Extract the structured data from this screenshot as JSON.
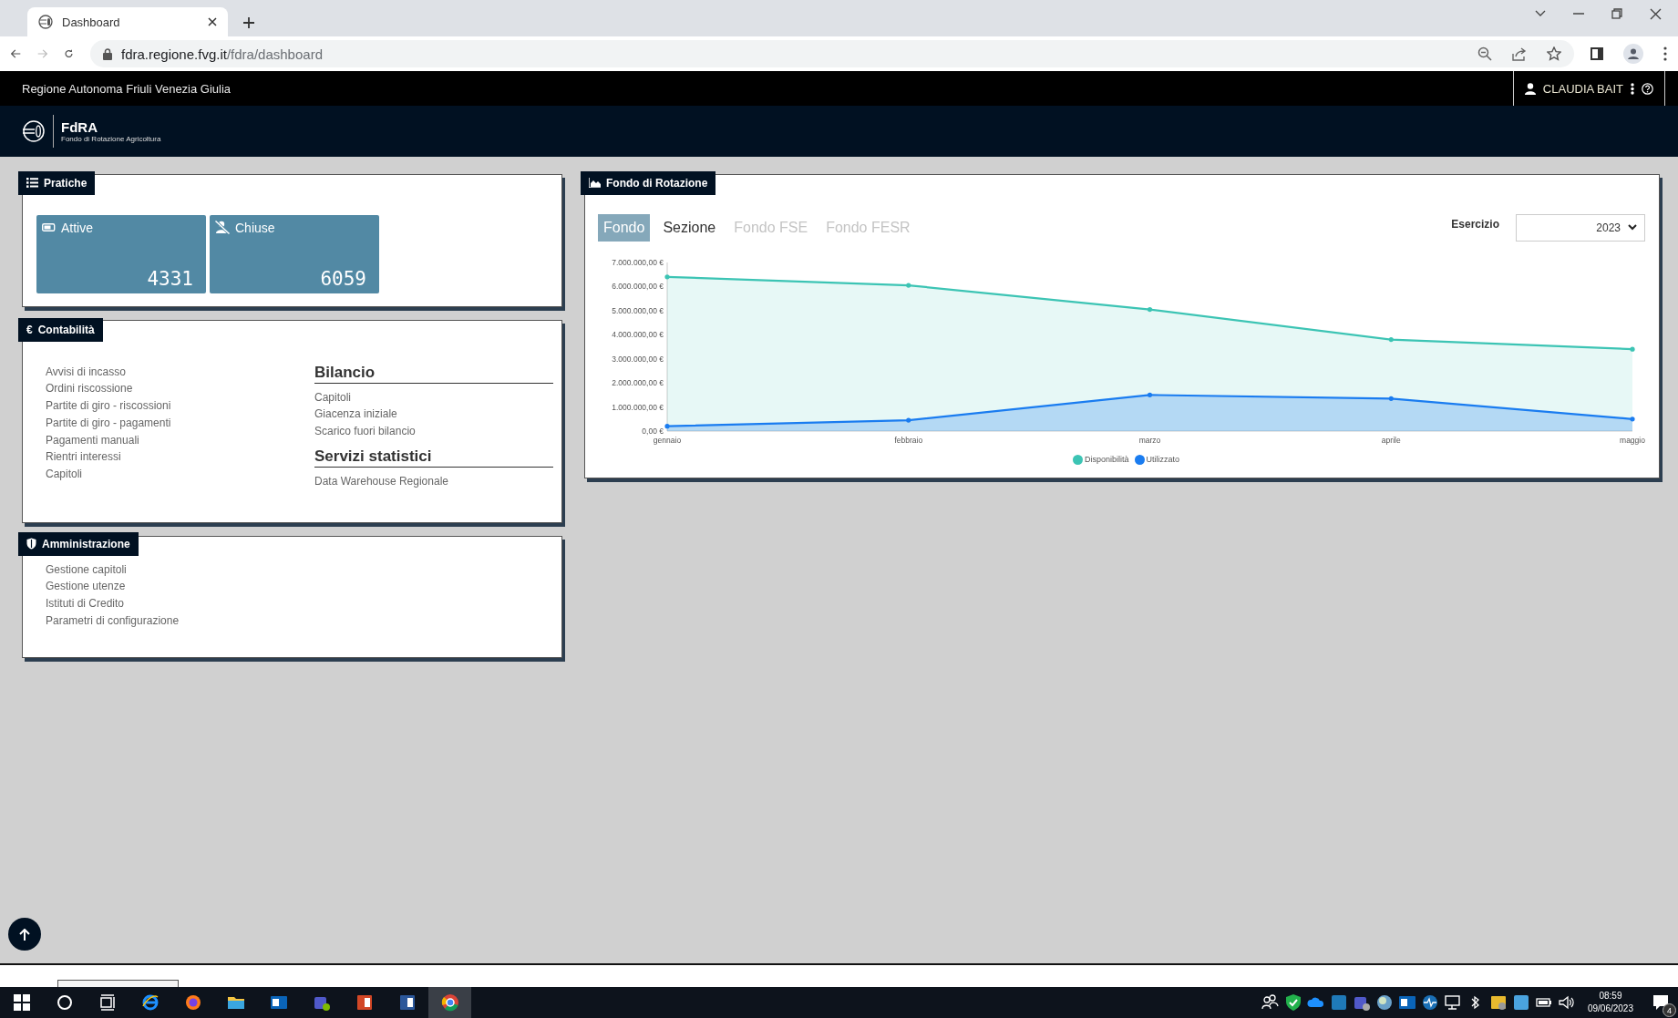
{
  "browser": {
    "tab": {
      "title": "Dashboard"
    },
    "url": {
      "host": "fdra.regione.fvg.it",
      "path": "/fdra/dashboard"
    }
  },
  "header": {
    "region": "Regione Autonoma Friuli Venezia Giulia",
    "user": "CLAUDIA BAIT",
    "app_name": "FdRA",
    "app_subtitle": "Fondo di Rotazione Agricoltura"
  },
  "pratiche": {
    "title": "Pratiche",
    "tiles": [
      {
        "kind": "active",
        "label": "Attive",
        "count": "4331"
      },
      {
        "kind": "closed",
        "label": "Chiuse",
        "count": "6059"
      }
    ]
  },
  "contabilita": {
    "title": "Contabilità",
    "icon_char": "€",
    "links": [
      "Avvisi di incasso",
      "Ordini riscossione",
      "Partite di giro - riscossioni",
      "Partite di giro - pagamenti",
      "Pagamenti manuali",
      "Rientri interessi",
      "Capitoli"
    ],
    "sections": [
      {
        "heading": "Bilancio",
        "links": [
          "Capitoli",
          "Giacenza iniziale",
          "Scarico fuori bilancio"
        ]
      },
      {
        "heading": "Servizi statistici",
        "links": [
          "Data Warehouse Regionale"
        ]
      }
    ]
  },
  "amministrazione": {
    "title": "Amministrazione",
    "links": [
      "Gestione capitoli",
      "Gestione utenze",
      "Istituti di Credito",
      "Parametri di configurazione"
    ]
  },
  "fondo": {
    "title": "Fondo di Rotazione",
    "tabs": [
      {
        "label": "Fondo",
        "selected": true,
        "disabled": false
      },
      {
        "label": "Sezione",
        "selected": false,
        "disabled": false
      },
      {
        "label": "Fondo FSE",
        "selected": false,
        "disabled": true
      },
      {
        "label": "Fondo FESR",
        "selected": false,
        "disabled": true
      }
    ],
    "esercizio": {
      "label": "Esercizio",
      "value": "2023"
    },
    "chart_data": {
      "type": "area",
      "categories": [
        "gennaio",
        "febbraio",
        "marzo",
        "aprile",
        "maggio"
      ],
      "series": [
        {
          "name": "Disponibilità",
          "color": "#3cc4b4",
          "values": [
            6400000,
            6050000,
            5050000,
            3800000,
            3400000
          ]
        },
        {
          "name": "Utilizzato",
          "color": "#1a7cf0",
          "values": [
            200000,
            450000,
            1500000,
            1350000,
            500000
          ]
        }
      ],
      "ylim": [
        0,
        7000000
      ],
      "stacked": false,
      "legend": "bottom",
      "yticks": [
        {
          "value": 0,
          "label": "0,00 €"
        },
        {
          "value": 1000000,
          "label": "1.000.000,00 €"
        },
        {
          "value": 2000000,
          "label": "2.000.000,00 €"
        },
        {
          "value": 3000000,
          "label": "3.000.000,00 €"
        },
        {
          "value": 4000000,
          "label": "4.000.000,00 €"
        },
        {
          "value": 5000000,
          "label": "5.000.000,00 €"
        },
        {
          "value": 6000000,
          "label": "6.000.000,00 €"
        },
        {
          "value": 7000000,
          "label": "7.000.000,00 €"
        }
      ]
    }
  },
  "taskbar": {
    "time": "08:59",
    "date": "09/06/2023",
    "notifications": "4"
  }
}
